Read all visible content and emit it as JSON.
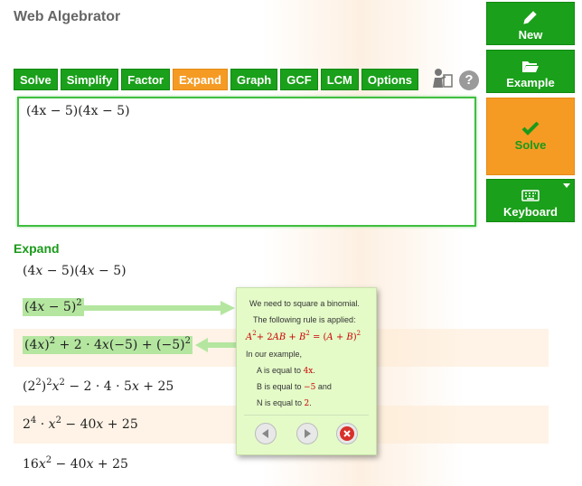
{
  "app": {
    "title": "Web Algebrator"
  },
  "toolbar": {
    "buttons": [
      "Solve",
      "Simplify",
      "Factor",
      "Expand",
      "Graph",
      "GCF",
      "LCM",
      "Options"
    ],
    "active": "Expand"
  },
  "sidebar": {
    "new_label": "New",
    "example_label": "Example",
    "solve_label": "Solve",
    "keyboard_label": "Keyboard"
  },
  "editor": {
    "expression": "(4x − 5)(4x − 5)"
  },
  "result": {
    "heading": "Expand"
  },
  "tooltip": {
    "line1": "We need to square a binomial.",
    "line2": "The following rule is applied:",
    "line4": "In our example,",
    "a_prefix": "A is equal to",
    "a_value": "4x",
    "b_prefix": "B is equal to",
    "b_value": "−5",
    "b_suffix": "and",
    "n_prefix": "N is equal to",
    "n_value": "2",
    "period": "."
  },
  "colors": {
    "green": "#1aa01a",
    "orange": "#f59b24",
    "highlight": "#b4e6a0",
    "tooltip_bg": "#e4fbc8"
  },
  "icons": [
    "pencil-icon",
    "folder-open-icon",
    "checkmark-icon",
    "keyboard-icon",
    "teacher-icon",
    "help-icon",
    "arrow-left-icon",
    "arrow-right-icon",
    "close-icon"
  ]
}
